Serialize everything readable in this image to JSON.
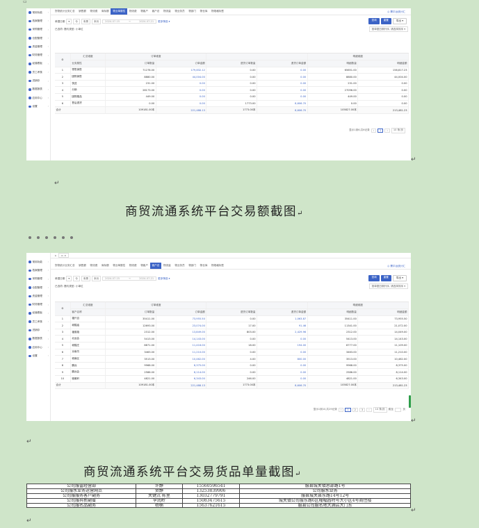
{
  "doc": {
    "return_mark": "↵",
    "caption1": "商贸流通系统平台交易额截图",
    "caption2": "商贸流通系统平台交易货品单量截图"
  },
  "sidebar": [
    "常用功能",
    "档案管理",
    "采购管理",
    "仓配管理",
    "资金管理",
    "财务管理",
    "经营看板",
    "员工考核",
    "进销存",
    "数据报表",
    "应用中心",
    "设置"
  ],
  "shot1": {
    "tabs": [
      "货物统计业务汇总",
      "销售额",
      "物流费",
      "商标额",
      "物业单属性",
      "物流费",
      "物客户",
      "客户总",
      "物流量",
      "物业务员",
      "物部门",
      "物仓库",
      "物规格标签"
    ],
    "active_tab": 4,
    "right_link": "◎ 需平台统计汇",
    "filter": {
      "label": "单据日期",
      "date_start": "2024-07-15",
      "date_end": "2024-07-21",
      "more": "更多筛选 ▾"
    },
    "buttons": {
      "search": "查询",
      "reset": "重置",
      "export": "导出 ▾"
    },
    "selected": "已选项: 履约类型: 小单位",
    "sort": "按单据日期升序, 请选择排序 ▾",
    "header_group": [
      "汇总维度",
      "订单维度",
      "",
      "明细维度"
    ],
    "headers": [
      "业务属性",
      "订单数量",
      "订单金额",
      "退货订单数量",
      "退货订单金额",
      "明细数量",
      "明细金额"
    ],
    "rows": [
      [
        "1",
        "零售销售",
        "71278.00",
        "179,832.12",
        "0.00",
        "0.00",
        "65651.00",
        "158,817.23"
      ],
      [
        "2",
        "团购销售",
        "8880.00",
        "44,004.00",
        "0.00",
        "0.00",
        "8880.00",
        "44,004.00"
      ],
      [
        "3",
        "快送",
        "231.00",
        "0.00",
        "0.00",
        "0.00",
        "231.00",
        "0.00"
      ],
      [
        "4",
        "分销",
        "28173.00",
        "0.00",
        "0.00",
        "0.00",
        "27096.00",
        "0.00"
      ],
      [
        "5",
        "团购赠品",
        "449.00",
        "0.00",
        "0.00",
        "0.00",
        "449.00",
        "0.00"
      ],
      [
        "6",
        "售后退货",
        "0.00",
        "0.00",
        "1773.00",
        "8,606.70",
        "0.00",
        "0.00"
      ]
    ],
    "total": [
      "合计",
      "109181.00本",
      "221,488.13",
      "1773.00本",
      "8,606.70",
      "105827.00本",
      "213,481.23"
    ],
    "pager": {
      "info": "显示1到6,共6记录",
      "p1": "1",
      "size": "10 条/页"
    }
  },
  "shot2": {
    "tabs": [
      "货物统计业务汇总",
      "销售额",
      "物流费",
      "商标额",
      "物业单属性",
      "物流费",
      "物客户",
      "客户总",
      "物流量",
      "物业务员",
      "物部门",
      "物仓库",
      "物规格标签"
    ],
    "active_tab": 7,
    "right_link": "◎ 需平台统计汇",
    "filter": {
      "label": "单据日期",
      "date_start": "2024-07-15",
      "date_end": "2024-07-21",
      "more": "更多筛选 ▾"
    },
    "buttons": {
      "search": "查询",
      "reset": "重置",
      "export": "导出 ▾"
    },
    "selected": "已选项: 履约类型: 小单位",
    "sort": "按单据日期升序, 请选择排序 ▾",
    "header_group": [
      "汇总维度",
      "订单维度",
      "",
      "明细维度"
    ],
    "headers": [
      "客户名称",
      "订单数量",
      "订单金额",
      "退货订单数量",
      "退货订单金额",
      "明细数量",
      "明细金额"
    ],
    "rows": [
      [
        "1",
        "福兴百",
        "35411.00",
        "73,955.50",
        "0.00",
        "1,063.87",
        "35411.00",
        "73,955.50"
      ],
      [
        "2",
        "城隍庙",
        "12693.00",
        "23,074.00",
        "17.00",
        "91.46",
        "11341.00",
        "21,072.00"
      ],
      [
        "3",
        "福惠路",
        "2312.00",
        "13,849.00",
        "803.00",
        "2,429.96",
        "2312.00",
        "14,049.00"
      ],
      [
        "4",
        "北运会",
        "5413.00",
        "14,143.00",
        "0.00",
        "0.00",
        "5413.00",
        "14,143.00"
      ],
      [
        "5",
        "城隍庄",
        "8871.00",
        "11,416.00",
        "18.00",
        "194.00",
        "8777.00",
        "11,109.00"
      ],
      [
        "6",
        "京南坊",
        "3463.00",
        "11,210.00",
        "0.00",
        "0.00",
        "3463.00",
        "11,210.00"
      ],
      [
        "7",
        "城南区",
        "3513.00",
        "10,462.00",
        "4.00",
        "800.00",
        "3513.00",
        "10,462.00"
      ],
      [
        "8",
        "鹏远",
        "9968.00",
        "8,375.00",
        "0.00",
        "0.00",
        "9968.00",
        "8,375.00"
      ],
      [
        "9",
        "鹏远会",
        "2586.00",
        "8,114.00",
        "0.00",
        "0.00",
        "2586.00",
        "8,114.00"
      ],
      [
        "10",
        "雅雅轩",
        "4821.00",
        "6,343.00",
        "246.00",
        "0.00",
        "4821.00",
        "6,343.00"
      ]
    ],
    "total": [
      "合计",
      "109181.00本",
      "221,488.13",
      "1773.00本",
      "8,606.70",
      "105827.00本",
      "213,481.23"
    ],
    "pager": {
      "info": "显示1到10,共29记录",
      "p1": "1",
      "p2": "2",
      "p3": "3",
      "size": "10 条/页",
      "goto": "跳至",
      "page": "页"
    }
  },
  "addresses": [
    [
      "公司服富经营部",
      "许静",
      "15560596541",
      "服县城关镇总部路1号"
    ],
    [
      "公司服水业务运营网点",
      "贺静",
      "13253839906",
      "公司服水业务"
    ],
    [
      "公司服服务客户副务",
      "关键沉 陈里",
      "13032779791",
      "服县城关县东路14号12号"
    ],
    [
      "公司服昇新副省",
      "李润岭",
      "15083475615",
      "城关镇公司服东路6区幢幅园特号大小区4号商住楼"
    ],
    [
      "公司服名品副务",
      "杨楠",
      "15637621615",
      "服县公司服名地大酒店大门东"
    ]
  ]
}
